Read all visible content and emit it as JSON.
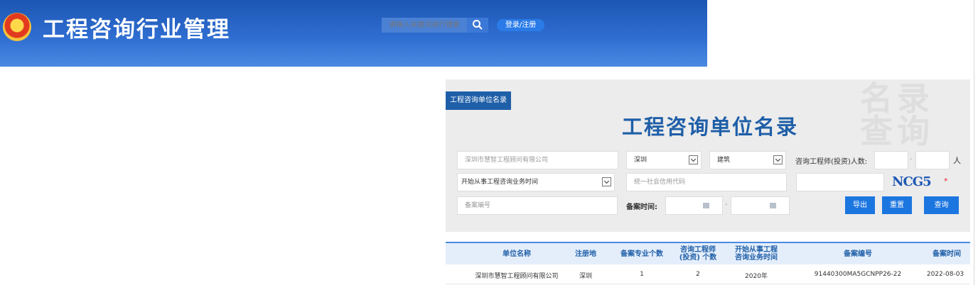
{
  "header": {
    "title": "工程咨询行业管理",
    "search_placeholder": "请输入关键词进行搜索",
    "login_label": "登录/注册"
  },
  "panel": {
    "tab_label": "工程咨询单位名录",
    "title": "工程咨询单位名录",
    "watermark": "名录查询",
    "company_name": "深圳市慧智工程顾问有限公司",
    "region": "深圳",
    "industry": "建筑",
    "engineer_count_label": "咨询工程师(投资)人数:",
    "range_sep": "-",
    "unit_label": "人",
    "start_time_select": "开始从事工程咨询业务时间",
    "credit_code_placeholder": "统一社会信用代码",
    "captcha_text": "NCG5",
    "required_mark": "*",
    "record_no_placeholder": "备案编号",
    "record_time_label": "备案时间:",
    "buttons": {
      "export": "导出",
      "reset": "重置",
      "query": "查询"
    }
  },
  "table": {
    "headers": {
      "name": "单位名称",
      "region": "注册地",
      "specialty_count": "备案专业个数",
      "engineer_count_l1": "咨询工程师",
      "engineer_count_l2": "(投资) 个数",
      "start_time_l1": "开始从事工程",
      "start_time_l2": "咨询业务时间",
      "record_no": "备案编号",
      "record_time": "备案时间"
    },
    "rows": [
      {
        "name": "深圳市慧智工程顾问有限公司",
        "region": "深圳",
        "specialty_count": "1",
        "engineer_count": "2",
        "start_time": "2020年",
        "record_no": "91440300MA5GCNPP26-22",
        "record_time": "2022-08-03"
      }
    ]
  },
  "colors": {
    "header_blue": "#1d56b3",
    "accent_blue": "#1f5fa8",
    "button_blue": "#1c76e0"
  }
}
